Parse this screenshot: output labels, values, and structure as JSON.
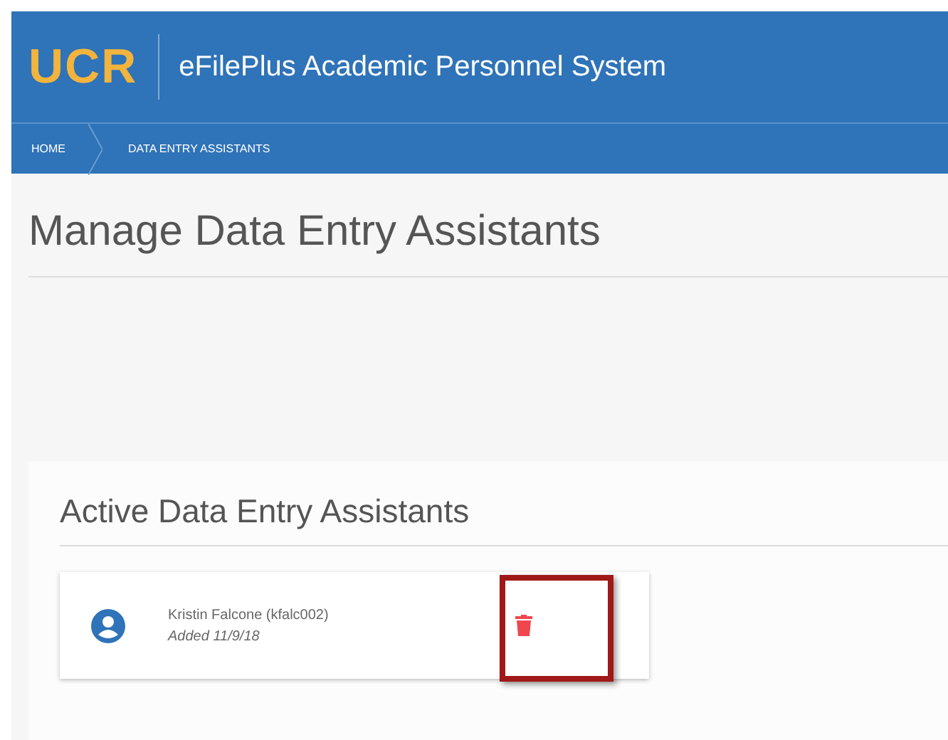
{
  "header": {
    "logo": "UCR",
    "title": "eFilePlus Academic Personnel System"
  },
  "breadcrumbs": [
    {
      "label": "HOME"
    },
    {
      "label": "DATA ENTRY ASSISTANTS"
    }
  ],
  "page_title": "Manage Data Entry Assistants",
  "section": {
    "title": "Active Data Entry Assistants",
    "assistants": [
      {
        "name": "Kristin Falcone (kfalc002)",
        "added": "Added 11/9/18",
        "highlighted": true
      }
    ]
  }
}
